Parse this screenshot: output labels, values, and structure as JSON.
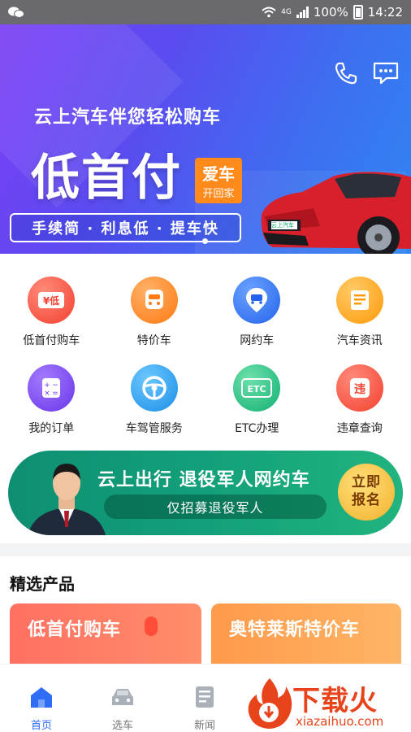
{
  "status_bar": {
    "network": "4G",
    "battery": "100%",
    "time": "14:22"
  },
  "banner": {
    "subtitle": "云上汽车伴您轻松购车",
    "headline": "低首付",
    "badge_line1": "爱车",
    "badge_line2": "开回家",
    "pill": "手续简 · 利息低 · 提车快",
    "car_plate": "云上汽车"
  },
  "services": [
    {
      "label": "低首付购车",
      "glyph": "¥低",
      "color": "#ff5a4c",
      "icon": "low-down-payment-icon"
    },
    {
      "label": "特价车",
      "glyph": "",
      "color": "#ff8a1c",
      "icon": "special-price-car-icon"
    },
    {
      "label": "网约车",
      "glyph": "",
      "color": "#3b7cf6",
      "icon": "ride-hailing-icon"
    },
    {
      "label": "汽车资讯",
      "glyph": "",
      "color": "#ffa21c",
      "icon": "car-news-icon"
    },
    {
      "label": "我的订单",
      "glyph": "",
      "color": "#7a4df0",
      "icon": "orders-icon"
    },
    {
      "label": "车驾管服务",
      "glyph": "",
      "color": "#2fa0f0",
      "icon": "steering-wheel-icon"
    },
    {
      "label": "ETC办理",
      "glyph": "ETC",
      "color": "#1fc083",
      "icon": "etc-icon"
    },
    {
      "label": "违章查询",
      "glyph": "违",
      "color": "#ff5a4c",
      "icon": "violation-icon"
    }
  ],
  "promo": {
    "title": "云上出行 退役军人网约车",
    "subtitle": "仅招募退役军人",
    "button_line1": "立即",
    "button_line2": "报名"
  },
  "featured": {
    "title": "精选产品",
    "cards": [
      {
        "title": "低首付购车"
      },
      {
        "title": "奥特莱斯特价车"
      }
    ]
  },
  "tabs": [
    {
      "label": "首页",
      "active": true
    },
    {
      "label": "选车",
      "active": false
    },
    {
      "label": "新闻",
      "active": false
    }
  ],
  "watermark": {
    "text": "下载火",
    "sub": "xiazaihuo.com"
  }
}
